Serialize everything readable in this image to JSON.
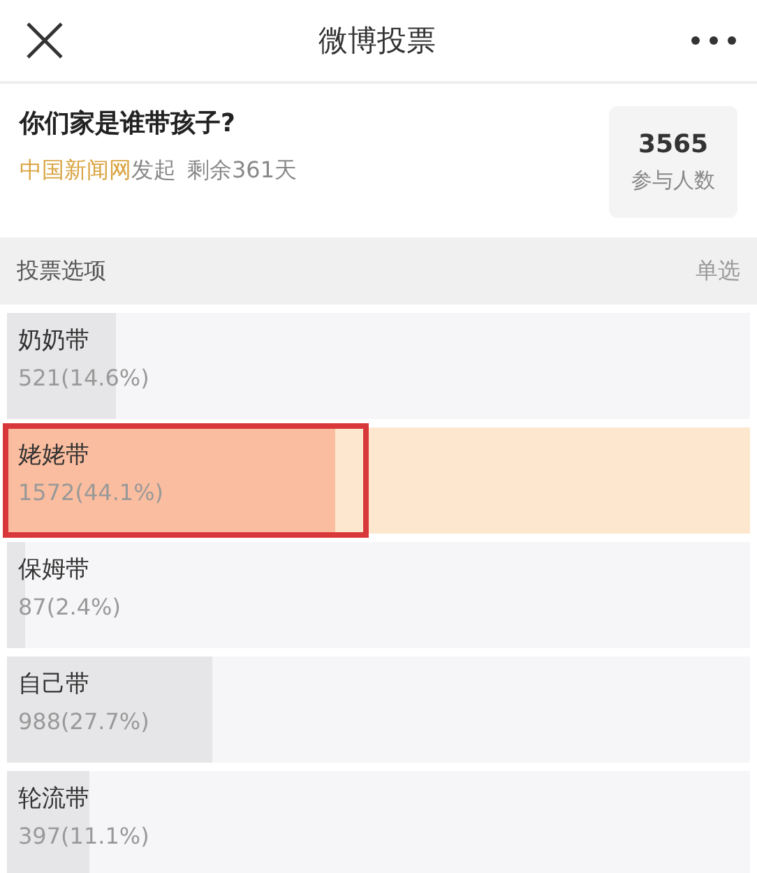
{
  "header": {
    "title": "微博投票"
  },
  "poll": {
    "question": "你们家是谁带孩子?",
    "source": "中国新闻网",
    "source_suffix": "发起",
    "remaining": "剩余361天",
    "participants": "3565",
    "participants_label": "参与人数"
  },
  "options_header": {
    "label": "投票选项",
    "mode": "单选"
  },
  "options": [
    {
      "label": "奶奶带",
      "count": "521(14.6%)",
      "level": 0.146,
      "selected": false
    },
    {
      "label": "姥姥带",
      "count": "1572(44.1%)",
      "level": 0.441,
      "selected": true
    },
    {
      "label": "保姆带",
      "count": "87(2.4%)",
      "level": 0.024,
      "selected": false
    },
    {
      "label": "自己带",
      "count": "988(27.7%)",
      "level": 0.277,
      "selected": false
    },
    {
      "label": "轮流带",
      "count": "397(11.1%)",
      "level": 0.111,
      "selected": false
    }
  ]
}
